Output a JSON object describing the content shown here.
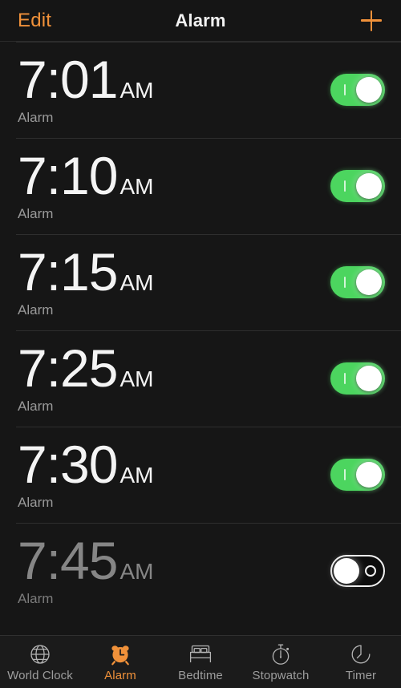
{
  "header": {
    "edit_label": "Edit",
    "title": "Alarm",
    "add_icon": "plus-icon",
    "accent_color": "#f0913a"
  },
  "alarms": [
    {
      "time": "7:01",
      "meridiem": "AM",
      "label": "Alarm",
      "enabled": true
    },
    {
      "time": "7:10",
      "meridiem": "AM",
      "label": "Alarm",
      "enabled": true
    },
    {
      "time": "7:15",
      "meridiem": "AM",
      "label": "Alarm",
      "enabled": true
    },
    {
      "time": "7:25",
      "meridiem": "AM",
      "label": "Alarm",
      "enabled": true
    },
    {
      "time": "7:30",
      "meridiem": "AM",
      "label": "Alarm",
      "enabled": true
    },
    {
      "time": "7:45",
      "meridiem": "AM",
      "label": "Alarm",
      "enabled": false
    }
  ],
  "tabbar": {
    "active_index": 1,
    "active_color": "#f0913a",
    "inactive_color": "#9d9d9d",
    "items": [
      {
        "label": "World Clock",
        "icon": "globe-icon"
      },
      {
        "label": "Alarm",
        "icon": "alarm-clock-icon"
      },
      {
        "label": "Bedtime",
        "icon": "bed-icon"
      },
      {
        "label": "Stopwatch",
        "icon": "stopwatch-icon"
      },
      {
        "label": "Timer",
        "icon": "timer-icon"
      }
    ]
  },
  "colors": {
    "switch_on": "#4cd55f",
    "background": "#161616",
    "navbar_background": "#151515",
    "tabbar_background": "#1b1b1b"
  }
}
